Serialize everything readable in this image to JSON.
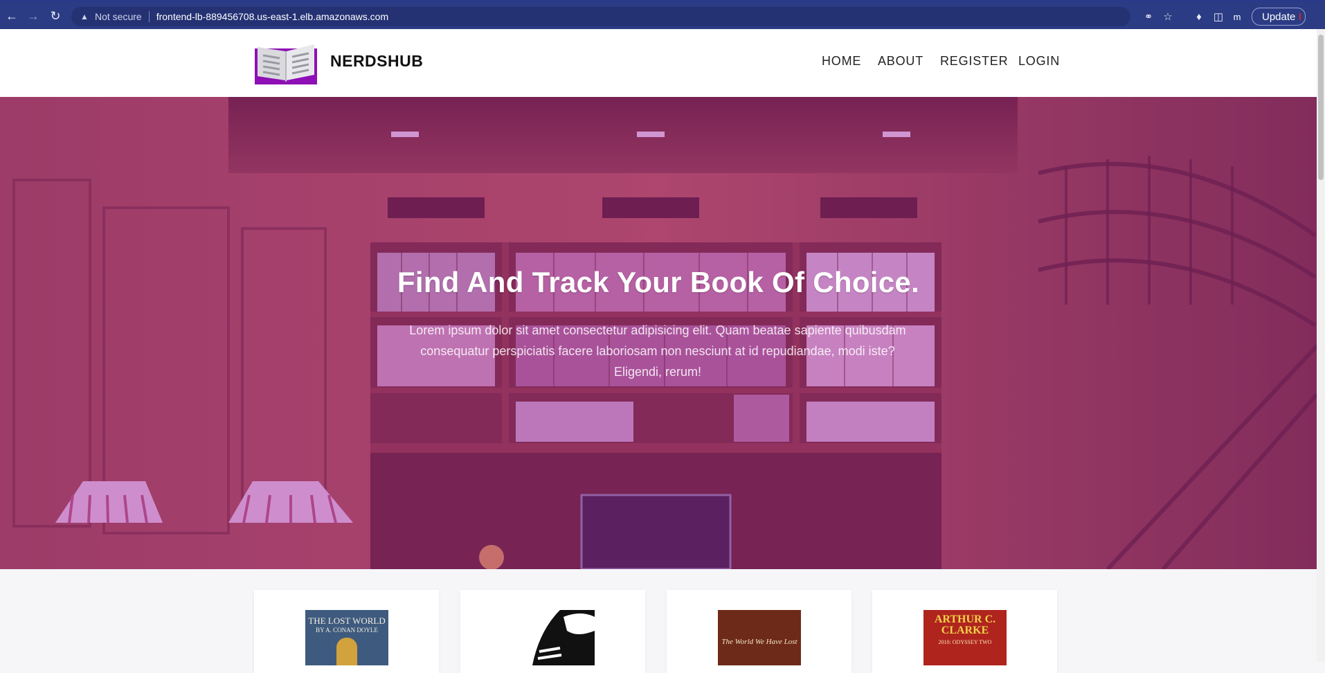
{
  "browser": {
    "security_label": "Not secure",
    "url": "frontend-lb-889456708.us-east-1.elb.amazonaws.com",
    "profile_initial": "m",
    "update_label": "Update",
    "icons": [
      "back-icon",
      "forward-icon",
      "reload-icon",
      "warning-icon",
      "share-icon",
      "star-icon",
      "extensions-icon",
      "side-panel-icon"
    ]
  },
  "site": {
    "brand": "NERDSHUB",
    "nav": [
      "HOME",
      "ABOUT",
      "REGISTER",
      "LOGIN"
    ],
    "accent_color": "#8e0fb5"
  },
  "hero": {
    "title": "Find And Track Your Book Of Choice.",
    "text": "Lorem ipsum dolor sit amet consectetur adipisicing elit. Quam beatae sapiente quibusdam consequatur perspiciatis facere laboriosam non nesciunt at id repudiandae, modi iste? Eligendi, rerum!"
  },
  "books": [
    {
      "cover_title": "THE LOST WORLD",
      "cover_author": "BY A. CONAN DOYLE"
    },
    {
      "cover_title": "",
      "cover_author": ""
    },
    {
      "cover_title": "The World We Have Lost",
      "cover_author": ""
    },
    {
      "cover_title": "ARTHUR C. CLARKE",
      "cover_author": "2010: ODYSSEY TWO"
    }
  ]
}
